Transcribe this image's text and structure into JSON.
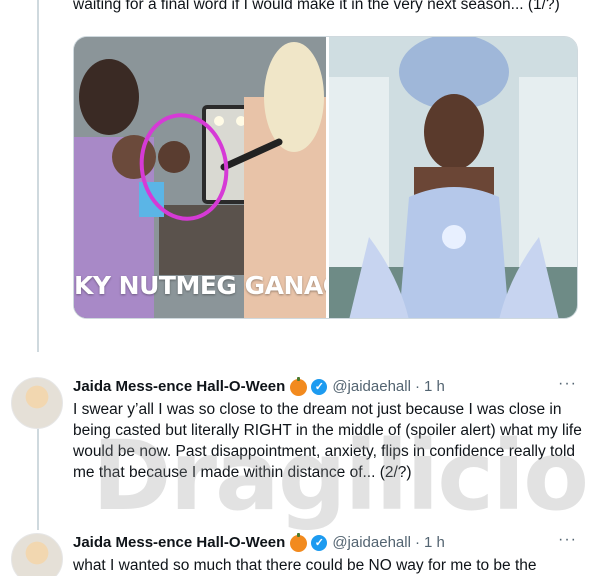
{
  "previous_tweet": {
    "text": "waiting for a final word if I would make it in the very next season... (1/?)"
  },
  "media": {
    "left_caption": "KY NUTMEG GANAC",
    "left_description_icon": "photo-icon",
    "right_description_icon": "photo-icon"
  },
  "tweets": [
    {
      "name": "Jaida Mess-ence Hall-O-Ween",
      "emoji": "jack-o-lantern-icon",
      "handle": "@jaidaehall",
      "separator": "·",
      "time": "1 h",
      "more": "···",
      "text": "I swear y’all I was so close to the dream not just because I was close in being casted but literally RIGHT in the middle of (spoiler alert) what my life would be now. Past disappointment, anxiety, flips in confidence really told me that because I made within distance of... (2/?)"
    },
    {
      "name": "Jaida Mess-ence Hall-O-Ween",
      "emoji": "jack-o-lantern-icon",
      "handle": "@jaidaehall",
      "separator": "·",
      "time": "1 h",
      "more": "···",
      "text": "what I wanted so much that there could be NO way for me to be the person"
    }
  ],
  "watermark": "Dragilicious",
  "colors": {
    "verified": "#1d9bf0",
    "muted": "#536471",
    "circle_annotation": "#d63ad6"
  }
}
